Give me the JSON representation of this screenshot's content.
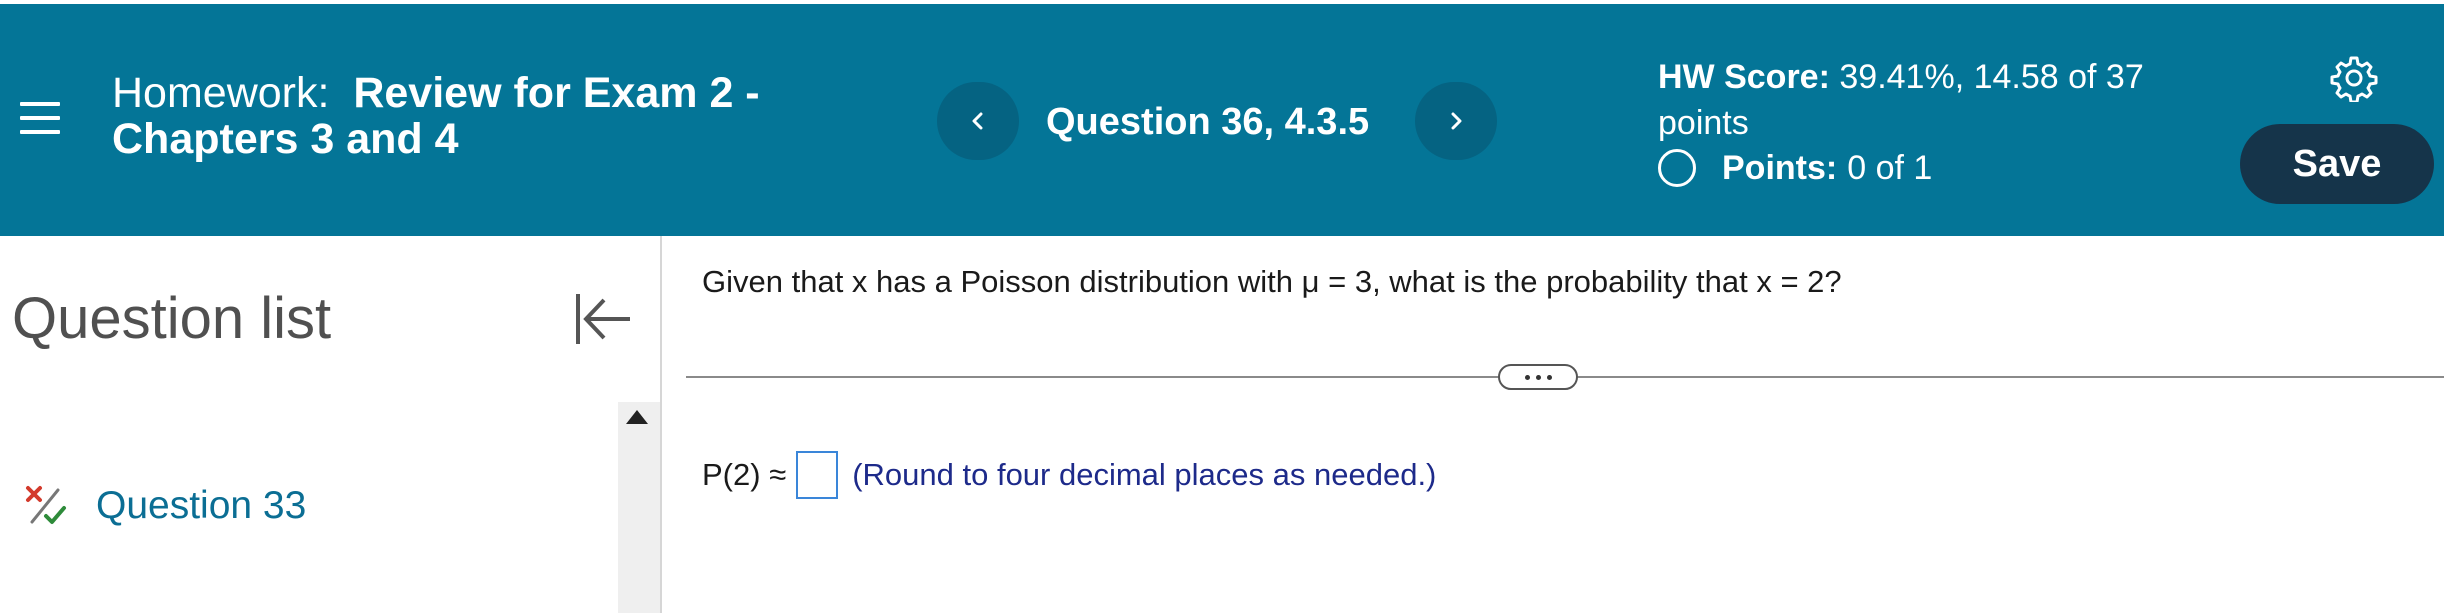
{
  "header": {
    "menu_icon": "hamburger-menu-icon",
    "homework_prefix": "Homework:",
    "homework_title_line1": "Review for Exam 2 -",
    "homework_title_line2": "Chapters 3 and 4",
    "question_label": "Question 36, 4.3.5",
    "prev_icon": "chevron-left-icon",
    "next_icon": "chevron-right-icon",
    "score_label": "HW Score:",
    "score_value_line1": "39.41%, 14.58 of 37",
    "score_value_line2": "points",
    "points_label": "Points:",
    "points_value": "0 of 1",
    "settings_icon": "gear-icon",
    "save_label": "Save"
  },
  "sidebar": {
    "title": "Question list",
    "collapse_icon": "collapse-left-icon",
    "items": [
      {
        "label": "Question 33",
        "status_icon": "partial-credit-icon"
      }
    ]
  },
  "question": {
    "text": "Given that x has a Poisson distribution with μ = 3, what is the probability that x = 2?",
    "answer_label": "P(2) ≈",
    "answer_value": "",
    "hint": "(Round to four decimal places as needed.)"
  },
  "colors": {
    "header_bg": "#047597",
    "nav_button_bg": "#056382",
    "save_button_bg": "#15344a",
    "link_color": "#0b6e94",
    "hint_color": "#1d2a8a",
    "input_border": "#3a86d9"
  }
}
